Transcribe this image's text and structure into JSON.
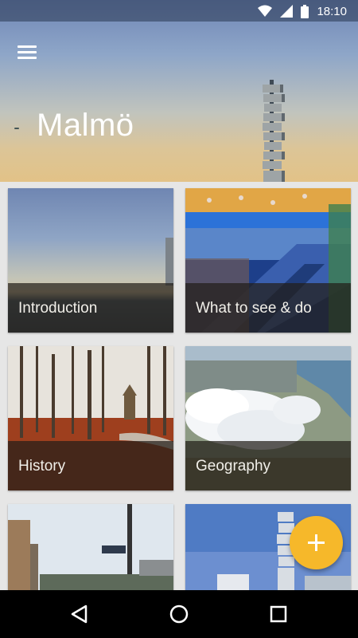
{
  "status_bar": {
    "time": "18:10",
    "icons": [
      "wifi-icon",
      "cell-signal-icon",
      "battery-icon"
    ]
  },
  "header": {
    "title": "Malmö",
    "menu_icon": "hamburger-menu-icon"
  },
  "cards": [
    {
      "label": "Introduction",
      "image": "sea-horizon-photo"
    },
    {
      "label": "What to see & do",
      "image": "shopping-mall-escalator-photo"
    },
    {
      "label": "History",
      "image": "autumn-park-photo"
    },
    {
      "label": "Geography",
      "image": "aerial-coast-clouds-photo"
    },
    {
      "label": "",
      "image": "city-street-photo"
    },
    {
      "label": "",
      "image": "turning-torso-photo"
    }
  ],
  "fab": {
    "icon": "plus-icon",
    "color": "#F6B82A"
  },
  "nav_bar": {
    "buttons": [
      "back-icon",
      "home-icon",
      "recents-icon"
    ]
  }
}
